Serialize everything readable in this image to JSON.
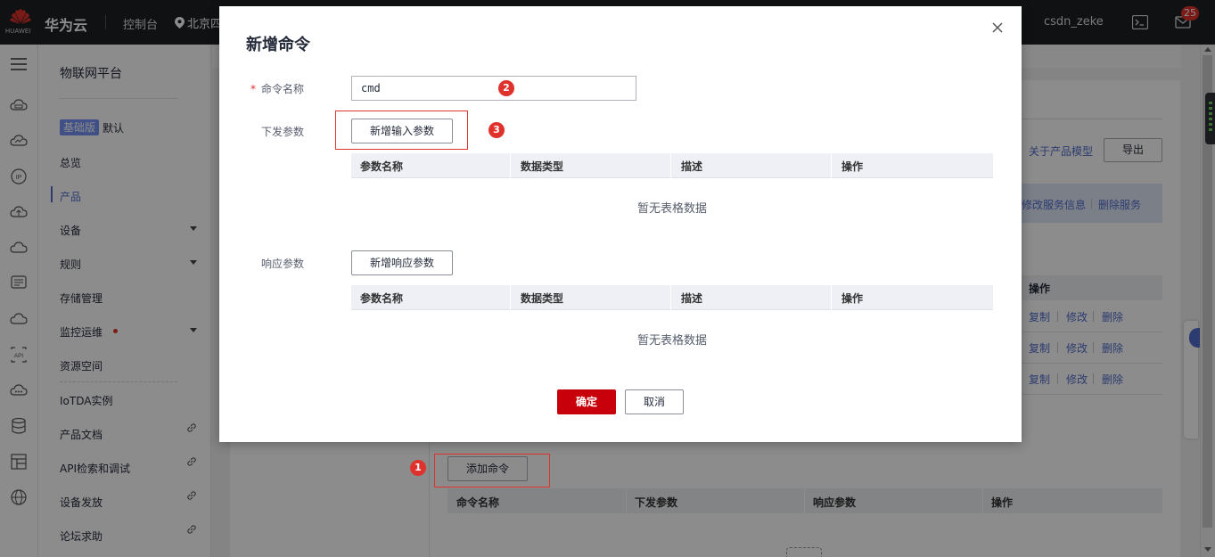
{
  "topbar": {
    "logo_text": "HUAWEI",
    "brand": "华为云",
    "console": "控制台",
    "region": "北京四",
    "user": "csdn_zeke",
    "notification_count": "25"
  },
  "nav": {
    "title": "物联网平台",
    "edition_tag": "基础版",
    "edition_value": "默认",
    "items": [
      {
        "label": "总览"
      },
      {
        "label": "产品"
      },
      {
        "label": "设备"
      },
      {
        "label": "规则"
      },
      {
        "label": "存储管理"
      },
      {
        "label": "监控运维"
      },
      {
        "label": "资源空间"
      },
      {
        "label": "IoTDA实例"
      },
      {
        "label": "产品文档"
      },
      {
        "label": "API检索和调试"
      },
      {
        "label": "设备发放"
      },
      {
        "label": "论坛求助"
      }
    ]
  },
  "background": {
    "about_model": "关于产品模型",
    "export": "导出",
    "edit_service": "修改服务信息",
    "delete_service": "删除服务",
    "ops_header": "操作",
    "row_actions": [
      "复制",
      "修改",
      "删除"
    ],
    "add_command": "添加命令",
    "cmd_table_headers": [
      "命令名称",
      "下发参数",
      "响应参数",
      "操作"
    ]
  },
  "modal": {
    "title": "新增命令",
    "name_label": "命令名称",
    "name_value": "cmd",
    "down_label": "下发参数",
    "add_input_param": "新增输入参数",
    "resp_label": "响应参数",
    "add_resp_param": "新增响应参数",
    "table_headers": [
      "参数名称",
      "数据类型",
      "描述",
      "操作"
    ],
    "empty_text": "暂无表格数据",
    "confirm": "确定",
    "cancel": "取消"
  },
  "annotations": [
    "1",
    "2",
    "3"
  ],
  "colors": {
    "primary_red": "#c7000b",
    "annotation_red": "#e0322d",
    "link_blue": "#526ecc",
    "topbar_bg": "#1e1f23"
  }
}
